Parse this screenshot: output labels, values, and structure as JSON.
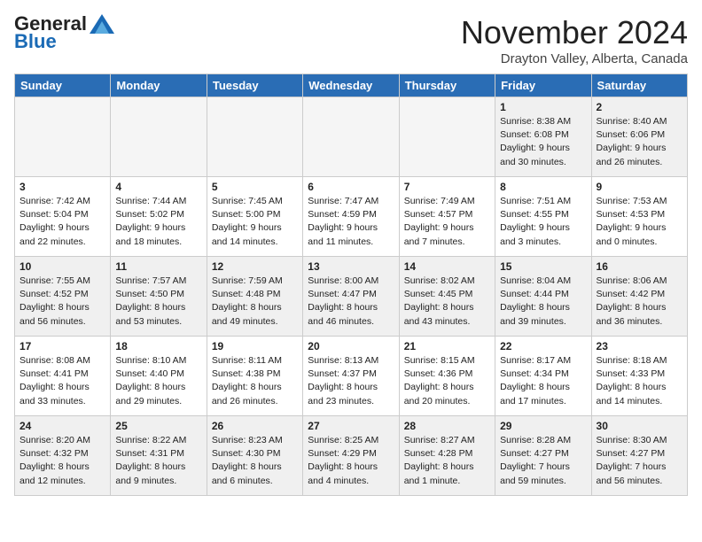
{
  "header": {
    "logo_general": "General",
    "logo_blue": "Blue",
    "title": "November 2024",
    "location": "Drayton Valley, Alberta, Canada"
  },
  "weekdays": [
    "Sunday",
    "Monday",
    "Tuesday",
    "Wednesday",
    "Thursday",
    "Friday",
    "Saturday"
  ],
  "weeks": [
    [
      {
        "day": "",
        "info": "",
        "empty": true
      },
      {
        "day": "",
        "info": "",
        "empty": true
      },
      {
        "day": "",
        "info": "",
        "empty": true
      },
      {
        "day": "",
        "info": "",
        "empty": true
      },
      {
        "day": "",
        "info": "",
        "empty": true
      },
      {
        "day": "1",
        "info": "Sunrise: 8:38 AM\nSunset: 6:08 PM\nDaylight: 9 hours and 30 minutes."
      },
      {
        "day": "2",
        "info": "Sunrise: 8:40 AM\nSunset: 6:06 PM\nDaylight: 9 hours and 26 minutes."
      }
    ],
    [
      {
        "day": "3",
        "info": "Sunrise: 7:42 AM\nSunset: 5:04 PM\nDaylight: 9 hours and 22 minutes."
      },
      {
        "day": "4",
        "info": "Sunrise: 7:44 AM\nSunset: 5:02 PM\nDaylight: 9 hours and 18 minutes."
      },
      {
        "day": "5",
        "info": "Sunrise: 7:45 AM\nSunset: 5:00 PM\nDaylight: 9 hours and 14 minutes."
      },
      {
        "day": "6",
        "info": "Sunrise: 7:47 AM\nSunset: 4:59 PM\nDaylight: 9 hours and 11 minutes."
      },
      {
        "day": "7",
        "info": "Sunrise: 7:49 AM\nSunset: 4:57 PM\nDaylight: 9 hours and 7 minutes."
      },
      {
        "day": "8",
        "info": "Sunrise: 7:51 AM\nSunset: 4:55 PM\nDaylight: 9 hours and 3 minutes."
      },
      {
        "day": "9",
        "info": "Sunrise: 7:53 AM\nSunset: 4:53 PM\nDaylight: 9 hours and 0 minutes."
      }
    ],
    [
      {
        "day": "10",
        "info": "Sunrise: 7:55 AM\nSunset: 4:52 PM\nDaylight: 8 hours and 56 minutes."
      },
      {
        "day": "11",
        "info": "Sunrise: 7:57 AM\nSunset: 4:50 PM\nDaylight: 8 hours and 53 minutes."
      },
      {
        "day": "12",
        "info": "Sunrise: 7:59 AM\nSunset: 4:48 PM\nDaylight: 8 hours and 49 minutes."
      },
      {
        "day": "13",
        "info": "Sunrise: 8:00 AM\nSunset: 4:47 PM\nDaylight: 8 hours and 46 minutes."
      },
      {
        "day": "14",
        "info": "Sunrise: 8:02 AM\nSunset: 4:45 PM\nDaylight: 8 hours and 43 minutes."
      },
      {
        "day": "15",
        "info": "Sunrise: 8:04 AM\nSunset: 4:44 PM\nDaylight: 8 hours and 39 minutes."
      },
      {
        "day": "16",
        "info": "Sunrise: 8:06 AM\nSunset: 4:42 PM\nDaylight: 8 hours and 36 minutes."
      }
    ],
    [
      {
        "day": "17",
        "info": "Sunrise: 8:08 AM\nSunset: 4:41 PM\nDaylight: 8 hours and 33 minutes."
      },
      {
        "day": "18",
        "info": "Sunrise: 8:10 AM\nSunset: 4:40 PM\nDaylight: 8 hours and 29 minutes."
      },
      {
        "day": "19",
        "info": "Sunrise: 8:11 AM\nSunset: 4:38 PM\nDaylight: 8 hours and 26 minutes."
      },
      {
        "day": "20",
        "info": "Sunrise: 8:13 AM\nSunset: 4:37 PM\nDaylight: 8 hours and 23 minutes."
      },
      {
        "day": "21",
        "info": "Sunrise: 8:15 AM\nSunset: 4:36 PM\nDaylight: 8 hours and 20 minutes."
      },
      {
        "day": "22",
        "info": "Sunrise: 8:17 AM\nSunset: 4:34 PM\nDaylight: 8 hours and 17 minutes."
      },
      {
        "day": "23",
        "info": "Sunrise: 8:18 AM\nSunset: 4:33 PM\nDaylight: 8 hours and 14 minutes."
      }
    ],
    [
      {
        "day": "24",
        "info": "Sunrise: 8:20 AM\nSunset: 4:32 PM\nDaylight: 8 hours and 12 minutes."
      },
      {
        "day": "25",
        "info": "Sunrise: 8:22 AM\nSunset: 4:31 PM\nDaylight: 8 hours and 9 minutes."
      },
      {
        "day": "26",
        "info": "Sunrise: 8:23 AM\nSunset: 4:30 PM\nDaylight: 8 hours and 6 minutes."
      },
      {
        "day": "27",
        "info": "Sunrise: 8:25 AM\nSunset: 4:29 PM\nDaylight: 8 hours and 4 minutes."
      },
      {
        "day": "28",
        "info": "Sunrise: 8:27 AM\nSunset: 4:28 PM\nDaylight: 8 hours and 1 minute."
      },
      {
        "day": "29",
        "info": "Sunrise: 8:28 AM\nSunset: 4:27 PM\nDaylight: 7 hours and 59 minutes."
      },
      {
        "day": "30",
        "info": "Sunrise: 8:30 AM\nSunset: 4:27 PM\nDaylight: 7 hours and 56 minutes."
      }
    ]
  ]
}
